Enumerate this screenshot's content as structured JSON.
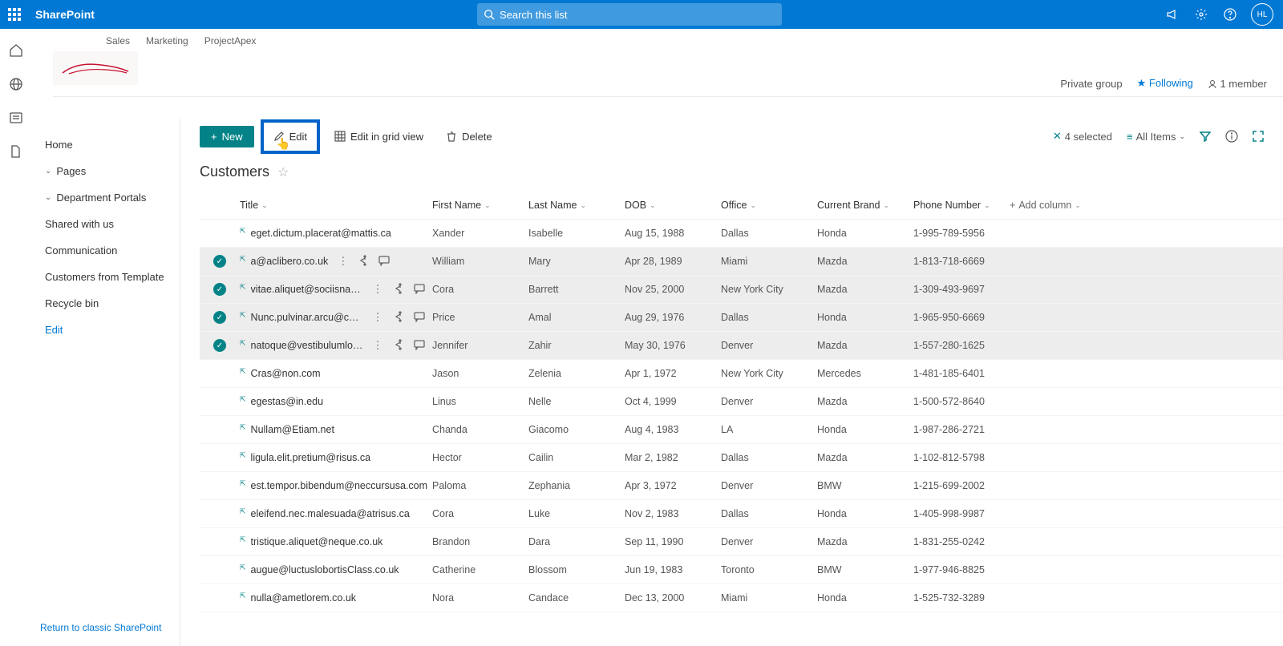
{
  "suite": {
    "app": "SharePoint",
    "search_placeholder": "Search this list",
    "avatar": "HL"
  },
  "topLinks": [
    "Sales",
    "Marketing",
    "ProjectApex"
  ],
  "siteInfo": {
    "privacy": "Private group",
    "follow": "Following",
    "members": "1 member"
  },
  "nav": {
    "home": "Home",
    "pages": "Pages",
    "dept": "Department Portals",
    "shared": "Shared with us",
    "comm": "Communication",
    "cft": "Customers from Template",
    "recycle": "Recycle bin",
    "edit": "Edit",
    "classic": "Return to classic SharePoint"
  },
  "cmd": {
    "new": "New",
    "edit": "Edit",
    "grid": "Edit in grid view",
    "delete": "Delete",
    "selected": "4 selected",
    "view": "All Items"
  },
  "list": {
    "title": "Customers"
  },
  "cols": {
    "title": "Title",
    "first": "First Name",
    "last": "Last Name",
    "dob": "DOB",
    "office": "Office",
    "brand": "Current Brand",
    "phone": "Phone Number",
    "add": "Add column"
  },
  "rows": [
    {
      "sel": false,
      "title": "eget.dictum.placerat@mattis.ca",
      "first": "Xander",
      "last": "Isabelle",
      "dob": "Aug 15, 1988",
      "office": "Dallas",
      "brand": "Honda",
      "phone": "1-995-789-5956"
    },
    {
      "sel": true,
      "title": "a@aclibero.co.uk",
      "first": "William",
      "last": "Mary",
      "dob": "Apr 28, 1989",
      "office": "Miami",
      "brand": "Mazda",
      "phone": "1-813-718-6669"
    },
    {
      "sel": true,
      "title": "vitae.aliquet@sociisnato...",
      "first": "Cora",
      "last": "Barrett",
      "dob": "Nov 25, 2000",
      "office": "New York City",
      "brand": "Mazda",
      "phone": "1-309-493-9697"
    },
    {
      "sel": true,
      "title": "Nunc.pulvinar.arcu@con...",
      "first": "Price",
      "last": "Amal",
      "dob": "Aug 29, 1976",
      "office": "Dallas",
      "brand": "Honda",
      "phone": "1-965-950-6669"
    },
    {
      "sel": true,
      "title": "natoque@vestibulumlor...",
      "first": "Jennifer",
      "last": "Zahir",
      "dob": "May 30, 1976",
      "office": "Denver",
      "brand": "Mazda",
      "phone": "1-557-280-1625"
    },
    {
      "sel": false,
      "title": "Cras@non.com",
      "first": "Jason",
      "last": "Zelenia",
      "dob": "Apr 1, 1972",
      "office": "New York City",
      "brand": "Mercedes",
      "phone": "1-481-185-6401"
    },
    {
      "sel": false,
      "title": "egestas@in.edu",
      "first": "Linus",
      "last": "Nelle",
      "dob": "Oct 4, 1999",
      "office": "Denver",
      "brand": "Mazda",
      "phone": "1-500-572-8640"
    },
    {
      "sel": false,
      "title": "Nullam@Etiam.net",
      "first": "Chanda",
      "last": "Giacomo",
      "dob": "Aug 4, 1983",
      "office": "LA",
      "brand": "Honda",
      "phone": "1-987-286-2721"
    },
    {
      "sel": false,
      "title": "ligula.elit.pretium@risus.ca",
      "first": "Hector",
      "last": "Cailin",
      "dob": "Mar 2, 1982",
      "office": "Dallas",
      "brand": "Mazda",
      "phone": "1-102-812-5798"
    },
    {
      "sel": false,
      "title": "est.tempor.bibendum@neccursusa.com",
      "first": "Paloma",
      "last": "Zephania",
      "dob": "Apr 3, 1972",
      "office": "Denver",
      "brand": "BMW",
      "phone": "1-215-699-2002"
    },
    {
      "sel": false,
      "title": "eleifend.nec.malesuada@atrisus.ca",
      "first": "Cora",
      "last": "Luke",
      "dob": "Nov 2, 1983",
      "office": "Dallas",
      "brand": "Honda",
      "phone": "1-405-998-9987"
    },
    {
      "sel": false,
      "title": "tristique.aliquet@neque.co.uk",
      "first": "Brandon",
      "last": "Dara",
      "dob": "Sep 11, 1990",
      "office": "Denver",
      "brand": "Mazda",
      "phone": "1-831-255-0242"
    },
    {
      "sel": false,
      "title": "augue@luctuslobortisClass.co.uk",
      "first": "Catherine",
      "last": "Blossom",
      "dob": "Jun 19, 1983",
      "office": "Toronto",
      "brand": "BMW",
      "phone": "1-977-946-8825"
    },
    {
      "sel": false,
      "title": "nulla@ametlorem.co.uk",
      "first": "Nora",
      "last": "Candace",
      "dob": "Dec 13, 2000",
      "office": "Miami",
      "brand": "Honda",
      "phone": "1-525-732-3289"
    }
  ]
}
